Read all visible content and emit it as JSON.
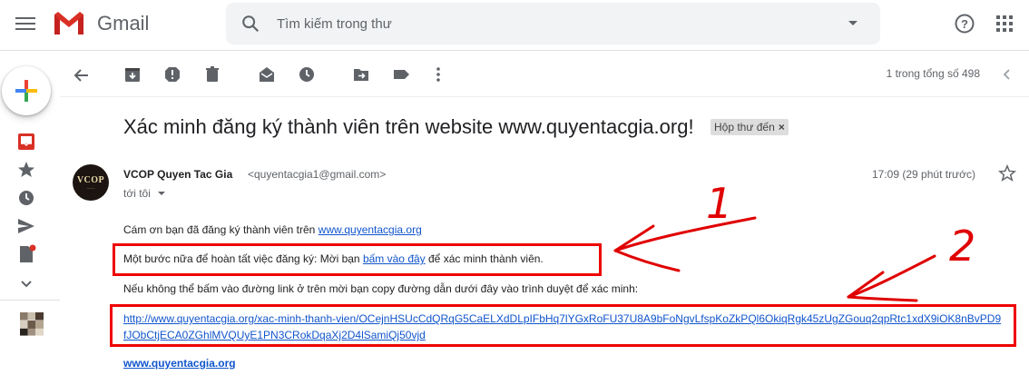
{
  "app": {
    "name": "Gmail"
  },
  "search": {
    "placeholder": "Tìm kiếm trong thư"
  },
  "toolbar": {
    "pager_text": "1 trong tổng số 498"
  },
  "message": {
    "subject": "Xác minh đăng ký thành viên trên website www.quyentacgia.org!",
    "label": "Hộp thư đến",
    "label_close": "×",
    "sender_name": "VCOP Quyen Tac Gia",
    "sender_email": "<quyentacgia1@gmail.com>",
    "to": "tới tôi",
    "time": "17:09 (29 phút trước)",
    "avatar_text": "VCOP"
  },
  "body": {
    "line1_text": "Cám ơn bạn đã đăng ký thành viên trên ",
    "line1_link": "www.quyentacgia.org",
    "line2_text": "Một bước nữa để hoàn tất việc đăng ký: Mời bạn ",
    "line2_link": "bấm vào đây",
    "line2_suffix": " để xác minh thành viên.",
    "line3_text": "Nếu không thể bấm vào đường link ở trên mời bạn copy đường dẫn dưới đây vào trình duyệt để xác minh:",
    "long_link": "http://www.quyentacgia.org/xac-minh-thanh-vien/OCejnHSUcCdQRqG5CaELXdDLpIFbHq7lYGxRoFU37U8A9bFoNgvLfspKoZkPQl6OkiqRgk45zUgZGouq2qpRtc1xdX9iOK8nBvPD9fJObCtjECA0ZGhlMVQUyE1PN3CRokDqaXj2D4lSamiQj50vjd",
    "footer_link": "www.quyentacgia.org"
  },
  "annotations": {
    "mark1": "1",
    "mark2": "2",
    "color": "#e00000"
  }
}
